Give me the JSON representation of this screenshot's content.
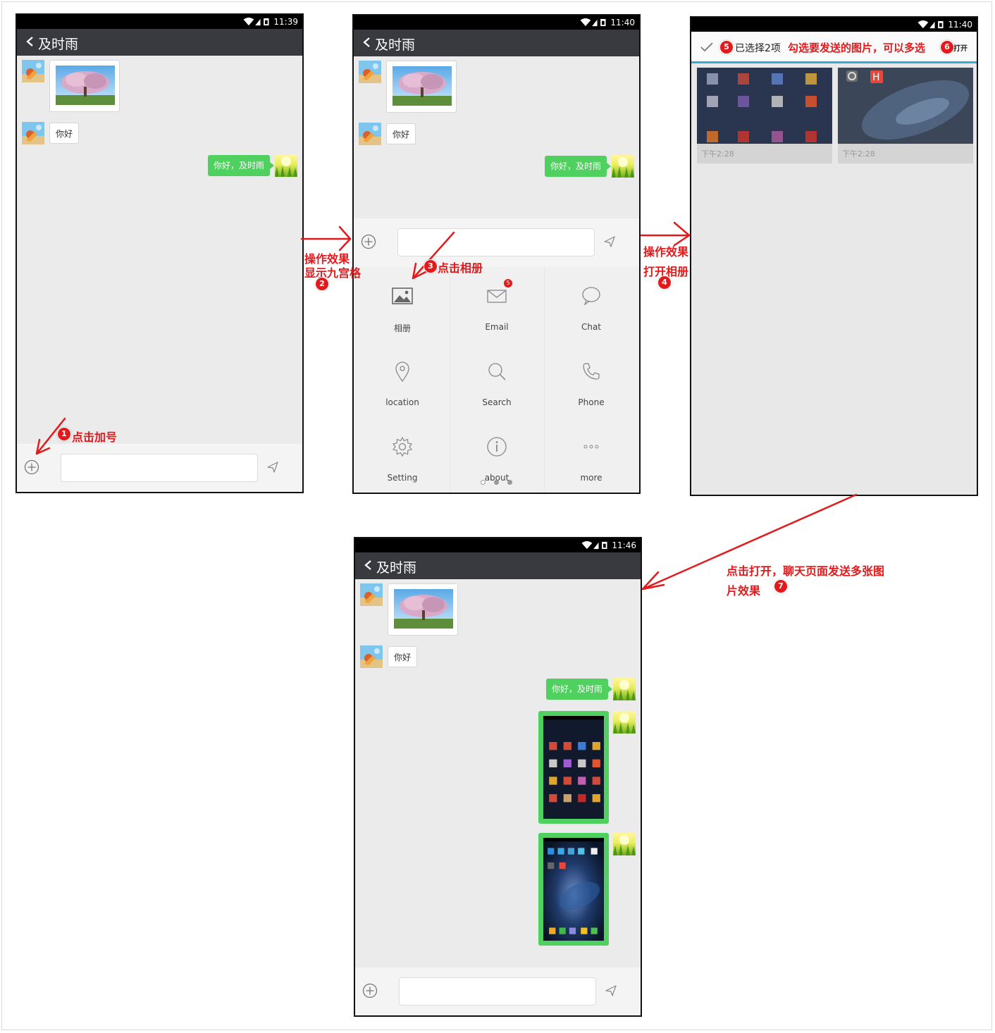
{
  "status_times": {
    "screen1": "11:39",
    "screen2": "11:40",
    "screen3": "11:40",
    "screen4": "11:46"
  },
  "chat_title": "及时雨",
  "messages": {
    "received_text": "你好",
    "sent_text": "你好，及时雨"
  },
  "grid_menu": {
    "items": [
      {
        "label": "相册",
        "icon": "picture-icon"
      },
      {
        "label": "Email",
        "icon": "mail-icon",
        "badge": "5"
      },
      {
        "label": "Chat",
        "icon": "chat-bubble-icon"
      },
      {
        "label": "location",
        "icon": "location-pin-icon"
      },
      {
        "label": "Search",
        "icon": "search-icon"
      },
      {
        "label": "Phone",
        "icon": "phone-icon"
      },
      {
        "label": "Setting",
        "icon": "gear-icon"
      },
      {
        "label": "about",
        "icon": "info-icon"
      },
      {
        "label": "more",
        "icon": "more-dots-icon"
      }
    ],
    "page_count": 3,
    "active_page": 2
  },
  "album": {
    "selected_text": "已选择2项",
    "open_label": "打开",
    "photos": [
      {
        "time": "下午2:28"
      },
      {
        "time": "下午2:28"
      }
    ]
  },
  "annotations": {
    "step1": {
      "num": "1",
      "text": "点击加号"
    },
    "step2": {
      "num": "2",
      "line1": "操作效果",
      "line2": "显示九宫格"
    },
    "step3": {
      "num": "3",
      "text": "点击相册"
    },
    "step4": {
      "num": "4",
      "line1": "操作效果",
      "line2": "打开相册"
    },
    "step5": {
      "num": "5"
    },
    "step5_hint": "勾选要发送的图片，可以多选",
    "step6": {
      "num": "6"
    },
    "step7": {
      "num": "7",
      "line1": "点击打开，聊天页面发送多张图",
      "line2": "片效果"
    }
  },
  "colors": {
    "annotation_red": "#e3191b",
    "bubble_green": "#4fd05f",
    "titlebar": "#393a3f",
    "chat_bg": "#ebebeb"
  }
}
